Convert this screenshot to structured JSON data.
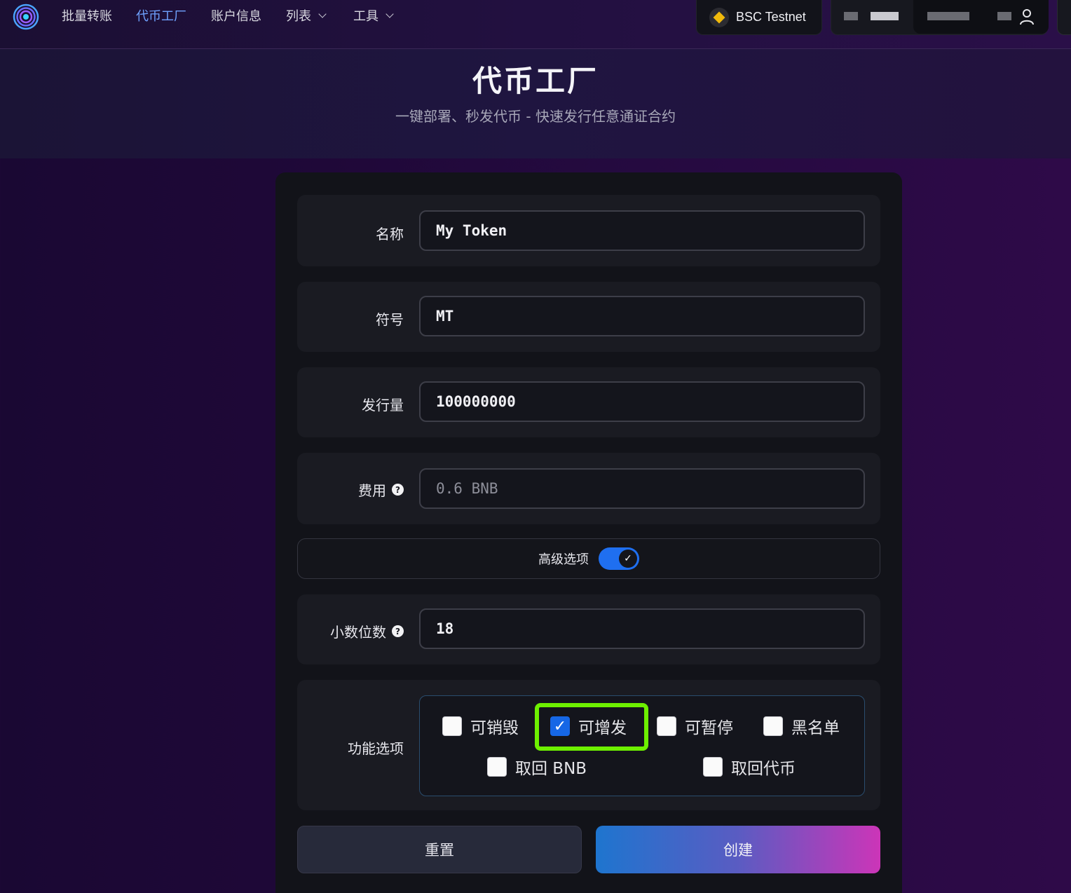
{
  "nav": {
    "items": [
      {
        "label": "批量转账",
        "active": false
      },
      {
        "label": "代币工厂",
        "active": true
      },
      {
        "label": "账户信息",
        "active": false
      },
      {
        "label": "列表",
        "active": false,
        "dropdown": true
      },
      {
        "label": "工具",
        "active": false,
        "dropdown": true
      }
    ],
    "network": "BSC Testnet"
  },
  "hero": {
    "title": "代币工厂",
    "subtitle": "一键部署、秒发代币 - 快速发行任意通证合约"
  },
  "form": {
    "name": {
      "label": "名称",
      "value": "My Token"
    },
    "symbol": {
      "label": "符号",
      "value": "MT"
    },
    "supply": {
      "label": "发行量",
      "value": "100000000"
    },
    "fee": {
      "label": "费用",
      "placeholder": "0.6 BNB"
    },
    "advanced": {
      "label": "高级选项",
      "enabled": true
    },
    "decimals": {
      "label": "小数位数",
      "value": "18"
    },
    "features": {
      "label": "功能选项",
      "options": [
        {
          "label": "可销毁",
          "checked": false
        },
        {
          "label": "可增发",
          "checked": true
        },
        {
          "label": "可暂停",
          "checked": false
        },
        {
          "label": "黑名单",
          "checked": false
        },
        {
          "label": "取回 BNB",
          "checked": false
        },
        {
          "label": "取回代币",
          "checked": false
        }
      ]
    }
  },
  "buttons": {
    "reset": "重置",
    "create": "创建"
  },
  "colors": {
    "accent_nav": "#6fa2ff",
    "toggle_on": "#1f6ff0",
    "highlight": "#6df000",
    "create_gradient": [
      "#1e75cf",
      "#5a5cc2",
      "#cc35b8"
    ]
  }
}
